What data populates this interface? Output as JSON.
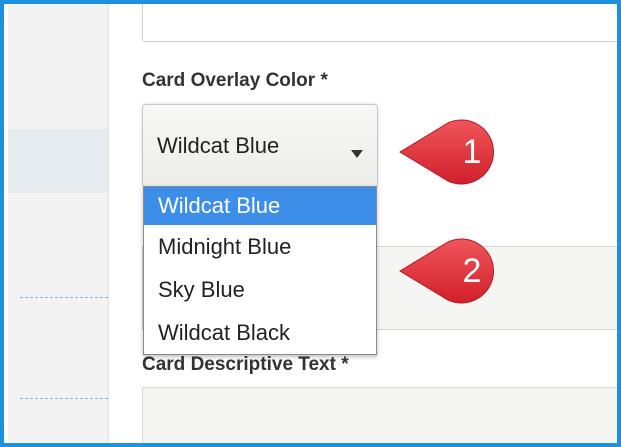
{
  "form": {
    "overlay_label": "Card Overlay Color *",
    "overlay_select": {
      "value": "Wildcat Blue",
      "options": [
        "Wildcat Blue",
        "Midnight Blue",
        "Sky Blue",
        "Wildcat Black"
      ],
      "selected_index": 0
    },
    "descriptive_label": "Card Descriptive Text *"
  },
  "callouts": [
    "1",
    "2"
  ],
  "colors": {
    "frame_border": "#1e90e0",
    "selected_option": "#3d8ee9",
    "callout": "#e8333d"
  }
}
